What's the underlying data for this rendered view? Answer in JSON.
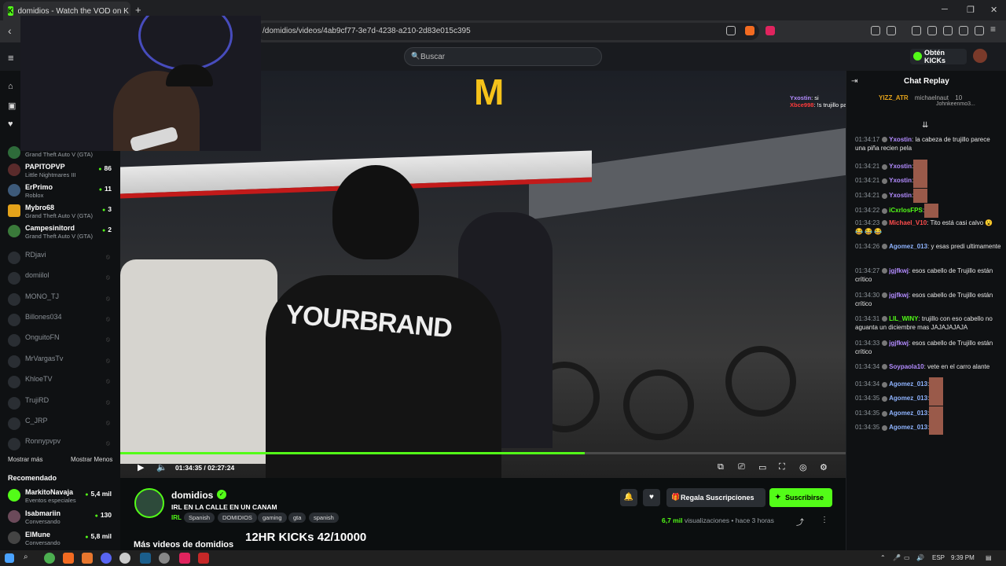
{
  "browser": {
    "tab_title": "domidios - Watch the VOD on K",
    "tab_close": "×",
    "new_tab": "+",
    "url": "/domidios/videos/4ab9cf77-3e7d-4238-a210-2d83e015c395",
    "min": "─",
    "max": "❐",
    "close": "✕"
  },
  "header": {
    "search_placeholder": "Buscar",
    "cta": "Obtén KICKs"
  },
  "sidebar": {
    "live": [
      {
        "name": "",
        "sub": "Grand Theft Auto V (GTA)",
        "count": ""
      },
      {
        "name": "PAPITOPVP",
        "sub": "Little Nightmares III",
        "count": "86"
      },
      {
        "name": "ErPrimo",
        "sub": "Roblox",
        "count": "11"
      },
      {
        "name": "Mybro68",
        "sub": "Grand Theft Auto V (GTA)",
        "count": "3"
      },
      {
        "name": "Campesinitord",
        "sub": "Grand Theft Auto V (GTA)",
        "count": "2"
      }
    ],
    "offline": [
      "RDjavi",
      "domiilol",
      "MONO_TJ",
      "Billones034",
      "OnguitoFN",
      "MrVargasTv",
      "KhloeTV",
      "TrujiRD",
      "C_JRP",
      "Ronnypvpv"
    ],
    "show_more": "Mostrar más",
    "show_less": "Mostrar Menos",
    "recommended_title": "Recomendado",
    "recommended": [
      {
        "name": "MarkitoNavaja",
        "sub": "Eventos especiales",
        "count": "5,4 mil"
      },
      {
        "name": "Isabmariin",
        "sub": "Conversando",
        "count": "130"
      },
      {
        "name": "ElMune",
        "sub": "Conversando",
        "count": "5,8 mil"
      }
    ]
  },
  "video": {
    "brand_sign": "M",
    "jersey": "YOURBRAND",
    "overlay_user1": "Yxostin",
    "overlay_msg1": ": si",
    "overlay_user2": "Xbce998",
    "overlay_msg2": ": !s trujillo parece el guaremate que compra la cerveza por chin de el",
    "progress_fraction": 0.64,
    "current_time": "01:34:35",
    "sep": "/",
    "duration": "02:27:24"
  },
  "chat": {
    "title": "Chat Replay",
    "pinned_user1": "YIZZ_ATR",
    "pinned_user2": "michaelnaut",
    "pinned_count": "10",
    "pinned_user3": "Johnkeenmo3...",
    "messages": [
      {
        "t": "01:34:17",
        "u": "Yxostin",
        "c": "#b38cff",
        "m": ": la cabeza de trujillo parece una piña recien pela"
      },
      {
        "t": "01:34:21",
        "u": "Yxostin",
        "c": "#b38cff",
        "m": ":",
        "emote": true
      },
      {
        "t": "01:34:21",
        "u": "Yxostin",
        "c": "#b38cff",
        "m": ":",
        "emote": true
      },
      {
        "t": "01:34:21",
        "u": "Yxostin",
        "c": "#b38cff",
        "m": ":",
        "emote": true
      },
      {
        "t": "01:34:22",
        "u": "iCxrlosFPS",
        "c": "#53fc18",
        "m": ":",
        "emote": true
      },
      {
        "t": "01:34:23",
        "u": "Michael_V10",
        "c": "#ff4d4d",
        "m": ": Tito está casi calvo 😮 😂 😂 😂"
      },
      {
        "t": "01:34:26",
        "u": "Agomez_013",
        "c": "#8fb4ff",
        "m": ": y esas predi ultimamente"
      },
      {
        "t": "01:34:27",
        "u": "jgjfkwj",
        "c": "#b38cff",
        "m": ": esos cabello de Trujillo están crítico"
      },
      {
        "t": "01:34:30",
        "u": "jgjfkwj",
        "c": "#b38cff",
        "m": ": esos cabello de Trujillo están crítico"
      },
      {
        "t": "01:34:31",
        "u": "LIL_WINY",
        "c": "#53fc18",
        "m": ": trujillo con eso cabello no aguanta un diciembre mas JAJAJAJAJA"
      },
      {
        "t": "01:34:33",
        "u": "jgjfkwj",
        "c": "#b38cff",
        "m": ": esos cabello de Trujillo están crítico"
      },
      {
        "t": "01:34:34",
        "u": "Soypaola10",
        "c": "#b38cff",
        "m": ": vete en el carro alante"
      },
      {
        "t": "01:34:34",
        "u": "Agomez_013",
        "c": "#8fb4ff",
        "m": ":",
        "emote": true
      },
      {
        "t": "01:34:35",
        "u": "Agomez_013",
        "c": "#8fb4ff",
        "m": ":",
        "emote": true
      },
      {
        "t": "01:34:35",
        "u": "Agomez_013",
        "c": "#8fb4ff",
        "m": ":",
        "emote": true
      },
      {
        "t": "01:34:35",
        "u": "Agomez_013",
        "c": "#8fb4ff",
        "m": ":",
        "emote": true
      }
    ]
  },
  "info": {
    "channel": "domidios",
    "stream_title": "IRL EN LA CALLE EN UN CANAM",
    "category": "IRL",
    "tags": [
      "Spanish",
      "DOMIDIOS",
      "gaming",
      "gta",
      "spanish"
    ],
    "gift": "Regala Suscripciones",
    "subscribe": "Suscribirse",
    "views_num": "6,7 mil",
    "views_label": "visualizaciones",
    "dot": "•",
    "ago": "hace 3 horas",
    "more_videos": "Más videos de domidios",
    "kicks_banner": "12HR KICKs 42/10000"
  },
  "taskbar": {
    "lang": "ESP",
    "time": "9:39 PM"
  },
  "colors": {
    "accent": "#53fc18"
  }
}
